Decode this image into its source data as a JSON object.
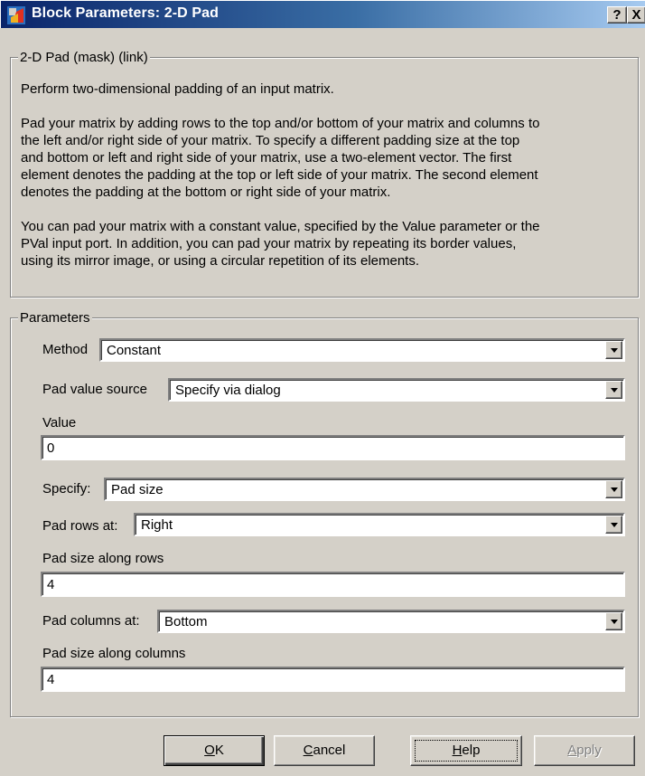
{
  "window": {
    "title": "Block Parameters: 2-D Pad",
    "help_button": "?",
    "close_button": "X"
  },
  "description_group": {
    "legend": "2-D Pad (mask) (link)",
    "paragraph1": "Perform two-dimensional padding of an input matrix.",
    "paragraph2_lines": [
      "Pad your matrix by adding rows to the top and/or bottom of your matrix and columns to",
      "the left and/or right side of your matrix. To specify a different padding size at the top",
      "and bottom or left and right side of your matrix, use a two-element vector. The first",
      "element denotes the padding at the top or left side of your matrix. The second element",
      "denotes the padding at the bottom or right side of your matrix."
    ],
    "paragraph3_lines": [
      "You can pad your matrix with a constant value, specified by the Value parameter or the",
      "PVal input port. In addition, you can pad your matrix by repeating its border values,",
      "using its mirror image, or using a circular repetition of its elements."
    ]
  },
  "parameters": {
    "legend": "Parameters",
    "method": {
      "label": "Method",
      "value": "Constant"
    },
    "pad_value_source": {
      "label": "Pad value source",
      "value": "Specify via dialog"
    },
    "value": {
      "label": "Value",
      "value": "0"
    },
    "specify": {
      "label": "Specify:",
      "value": "Pad size"
    },
    "pad_rows_at": {
      "label": "Pad rows at:",
      "value": "Right"
    },
    "pad_size_along_rows": {
      "label": "Pad size along rows",
      "value": "4"
    },
    "pad_columns_at": {
      "label": "Pad columns at:",
      "value": "Bottom"
    },
    "pad_size_along_columns": {
      "label": "Pad size along columns",
      "value": "4"
    }
  },
  "buttons": {
    "ok": {
      "mnemonic": "O",
      "rest": "K"
    },
    "cancel": {
      "mnemonic": "C",
      "rest": "ancel"
    },
    "help": {
      "mnemonic": "H",
      "rest": "elp"
    },
    "apply": {
      "mnemonic": "A",
      "rest": "pply"
    }
  }
}
